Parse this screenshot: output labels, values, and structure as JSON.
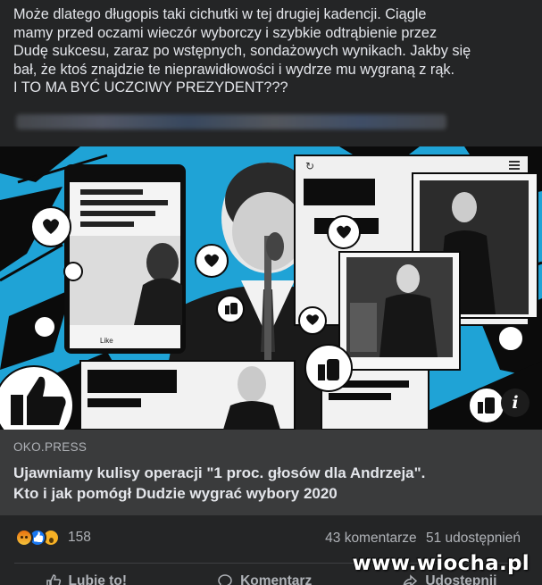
{
  "post": {
    "text_lines": [
      "Może dlatego długopis taki cichutki w tej drugiej kadencji. Ciągle",
      "mamy przed oczami wieczór wyborczy i szybkie odtrąbienie przez",
      "Dudę sukcesu, zaraz po wstępnych, sondażowych wynikach. Jakby się",
      "bał, że ktoś znajdzie te nieprawidłowości i wydrze mu wygraną z rąk.",
      "I TO MA BYĆ UCZCIWY PREZYDENT???"
    ]
  },
  "link_card": {
    "source": "OKO.PRESS",
    "headline_lines": [
      "Ujawniamy kulisy operacji \"1 proc. głosów dla Andrzeja\".",
      "Kto i jak pomógł Dudzie wygrać wybory 2020"
    ],
    "info_glyph": "i",
    "image_labels": {
      "like_small": "Like"
    }
  },
  "stats": {
    "reaction_count": "158",
    "comments": "43 komentarze",
    "shares": "51 udostępnień",
    "reaction_icons": [
      "angry",
      "like",
      "wow"
    ]
  },
  "actions": {
    "like": "Lubię to!",
    "comment": "Komentarz",
    "share": "Udostępnij"
  },
  "watermark": "www.wiocha.pl",
  "colors": {
    "background": "#242526",
    "card_footer": "#3a3b3c",
    "image_blue": "#1fa3d6",
    "text": "#e4e6eb",
    "muted": "#b0b3b8"
  }
}
